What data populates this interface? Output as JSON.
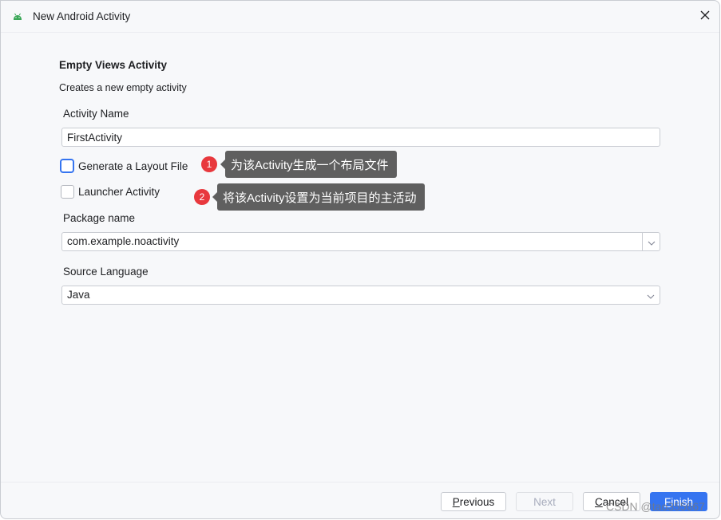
{
  "window": {
    "title": "New Android Activity",
    "app_icon": "android-icon",
    "close_icon": "close-icon"
  },
  "template": {
    "heading": "Empty Views Activity",
    "description": "Creates a new empty activity"
  },
  "form": {
    "activity_name": {
      "label": "Activity Name",
      "value": "FirstActivity"
    },
    "generate_layout": {
      "label": "Generate a Layout File",
      "checked": false,
      "focused": true
    },
    "launcher_activity": {
      "label": "Launcher Activity",
      "checked": false
    },
    "package_name": {
      "label": "Package name",
      "value": "com.example.noactivity"
    },
    "source_language": {
      "label": "Source Language",
      "value": "Java"
    }
  },
  "annotations": [
    {
      "number": "1",
      "text": "为该Activity生成一个布局文件"
    },
    {
      "number": "2",
      "text": "将该Activity设置为当前项目的主活动"
    }
  ],
  "footer": {
    "previous": {
      "mnemonic": "P",
      "rest": "revious",
      "enabled": true
    },
    "next": {
      "label": "Next",
      "enabled": false
    },
    "cancel": {
      "mnemonic": "C",
      "rest": "ancel",
      "enabled": true
    },
    "finish": {
      "mnemonic": "F",
      "rest": "inish",
      "enabled": true
    }
  },
  "colors": {
    "accent": "#3574f0",
    "badge": "#e8383d",
    "tooltip_bg": "#5f5f5f",
    "android_green": "#3ddc84"
  },
  "watermark": "CSDN @tao355667"
}
